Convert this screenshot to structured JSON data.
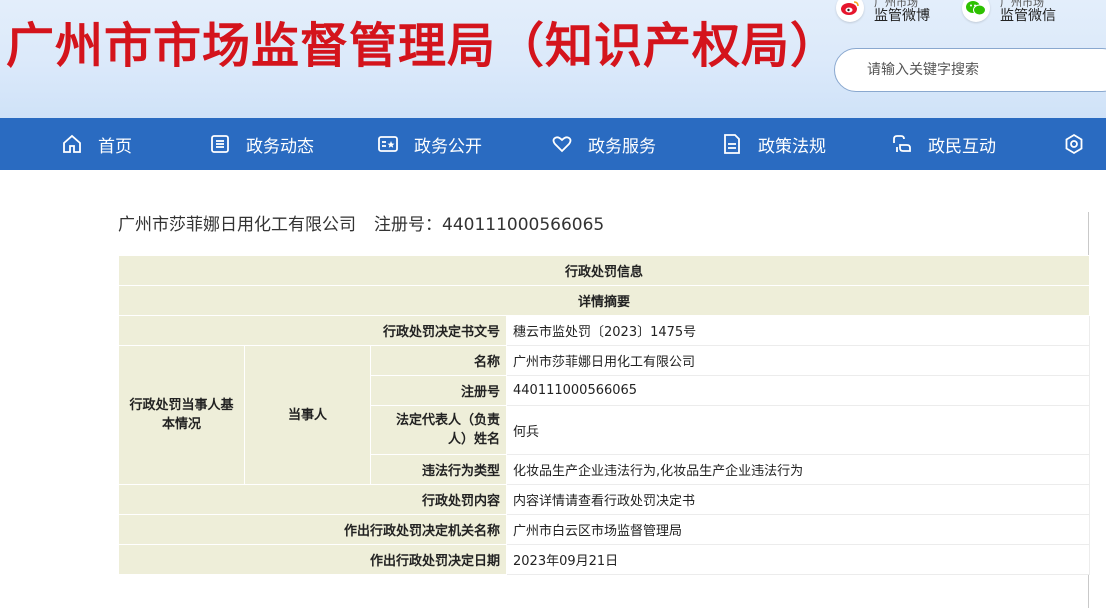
{
  "header": {
    "title": "广州市市场监督管理局（知识产权局）",
    "social": [
      {
        "icon": "weibo-icon",
        "line1": "广州市场",
        "line2": "监管微博"
      },
      {
        "icon": "wechat-icon",
        "line1": "广州市场",
        "line2": "监管微信"
      }
    ],
    "search_placeholder": "请输入关键字搜索"
  },
  "nav": [
    {
      "label": "首页",
      "icon": "home-icon"
    },
    {
      "label": "政务动态",
      "icon": "news-icon"
    },
    {
      "label": "政务公开",
      "icon": "open-info-icon"
    },
    {
      "label": "政务服务",
      "icon": "heart-icon"
    },
    {
      "label": "政策法规",
      "icon": "document-icon"
    },
    {
      "label": "政民互动",
      "icon": "interaction-icon"
    }
  ],
  "company": {
    "name": "广州市莎菲娜日用化工有限公司",
    "reg_label": "注册号：",
    "reg_no": "440111000566065"
  },
  "table": {
    "header1": "行政处罚信息",
    "header2": "详情摘要",
    "decision_no_label": "行政处罚决定书文号",
    "decision_no": "穗云市监处罚〔2023〕1475号",
    "party_basic_label": "行政处罚当事人基本情况",
    "party_label": "当事人",
    "name_label": "名称",
    "name_value": "广州市莎菲娜日用化工有限公司",
    "reg_label": "注册号",
    "reg_value": "440111000566065",
    "legal_rep_label": "法定代表人（负责人）姓名",
    "legal_rep_value": "何兵",
    "violation_type_label": "违法行为类型",
    "violation_type_value": "化妆品生产企业违法行为,化妆品生产企业违法行为",
    "penalty_content_label": "行政处罚内容",
    "penalty_content_value": "内容详情请查看行政处罚决定书",
    "authority_label": "作出行政处罚决定机关名称",
    "authority_value": "广州市白云区市场监督管理局",
    "date_label": "作出行政处罚决定日期",
    "date_value": "2023年09月21日"
  },
  "colors": {
    "title_red": "#d4141c",
    "nav_blue": "#2a6bc1",
    "label_bg": "#eeeed9"
  }
}
